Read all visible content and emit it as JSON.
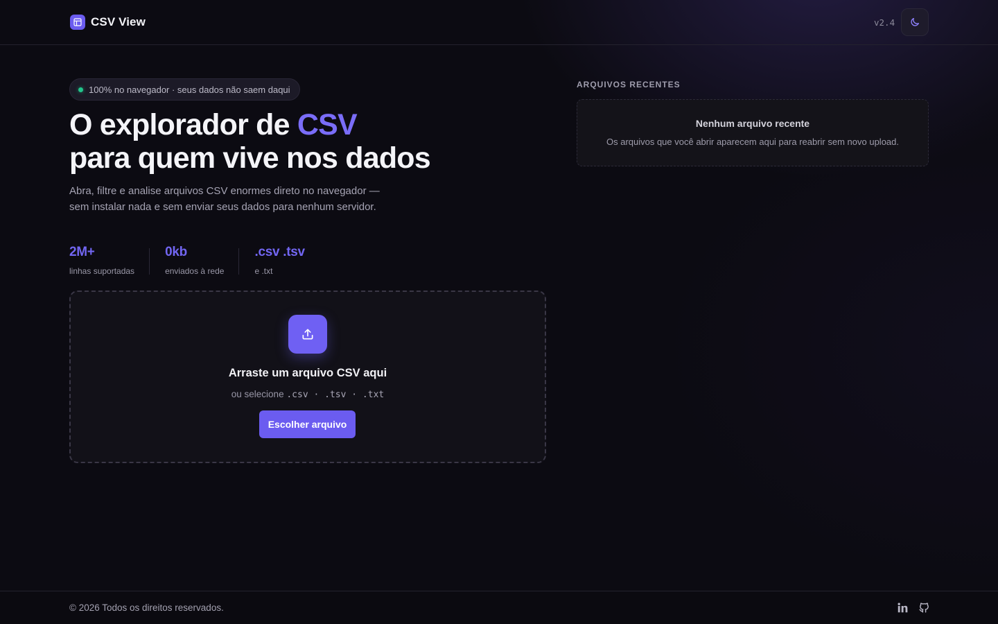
{
  "header": {
    "brand_name": "CSV View",
    "version": "v2.4",
    "icons": {
      "brand": "table-icon",
      "theme_toggle": "moon-icon"
    }
  },
  "hero": {
    "badge": "100% no navegador · seus dados não saem daqui",
    "headline_part1": "O explorador de ",
    "headline_accent": "CSV",
    "headline_part2": "para quem vive nos dados",
    "subtitle": "Abra, filtre e analise arquivos CSV enormes direto no navegador — sem instalar nada e sem enviar seus dados para nenhum servidor.",
    "stats": [
      {
        "value": "2M+",
        "label": "linhas suportadas"
      },
      {
        "value": "0kb",
        "label": "enviados à rede"
      },
      {
        "value": ".csv .tsv",
        "label": "e .txt"
      }
    ]
  },
  "dropzone": {
    "icon": "upload-icon",
    "title": "Arraste um arquivo CSV aqui",
    "sub_prefix": "ou selecione",
    "extensions": ".csv · .tsv · .txt",
    "button_label": "Escolher arquivo"
  },
  "recent": {
    "title": "ARQUIVOS RECENTES",
    "empty_title": "Nenhum arquivo recente",
    "empty_subtitle": "Os arquivos que você abrir aparecem aqui para reabrir sem novo upload."
  },
  "footer": {
    "copyright": "© 2026 Todos os direitos reservados.",
    "social_icons": [
      "linkedin-icon",
      "github-icon"
    ]
  },
  "colors": {
    "background": "#0c0b12",
    "accent": "#6b5cf0",
    "accent_text": "#7a6df8",
    "status_dot": "#22c58b"
  }
}
